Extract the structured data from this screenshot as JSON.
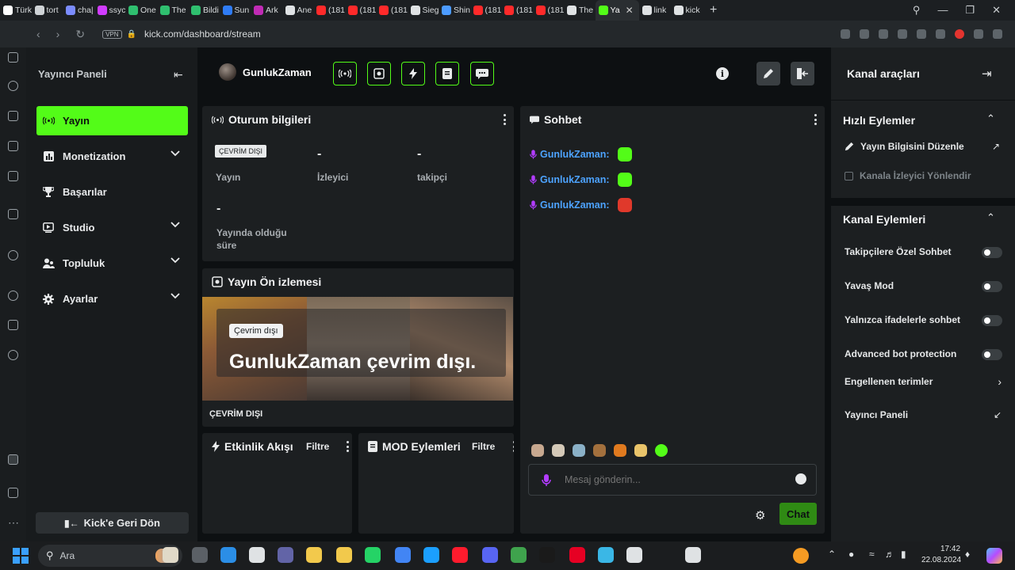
{
  "browser": {
    "tabs": [
      {
        "label": "Türk",
        "color": "#ffffff"
      },
      {
        "label": "tort",
        "color": "#cfd3d6"
      },
      {
        "label": "cha|",
        "color": "#7b8cff"
      },
      {
        "label": "ssyc",
        "color": "#d13cff"
      },
      {
        "label": "One",
        "color": "#2fbf6f"
      },
      {
        "label": "The",
        "color": "#2fbf6f"
      },
      {
        "label": "Bildi",
        "color": "#2fbf6f"
      },
      {
        "label": "Sun",
        "color": "#2f7cf6"
      },
      {
        "label": "Ark",
        "color": "#c02bb5"
      },
      {
        "label": "Ane",
        "color": "#dfe2e4"
      },
      {
        "label": "(181",
        "color": "#ff2a2a"
      },
      {
        "label": "(181",
        "color": "#ff2a2a"
      },
      {
        "label": "(181",
        "color": "#ff2a2a"
      },
      {
        "label": "Sieg",
        "color": "#dfe2e4"
      },
      {
        "label": "Shin",
        "color": "#4c9bff"
      },
      {
        "label": "(181",
        "color": "#ff2a2a"
      },
      {
        "label": "(181",
        "color": "#ff2a2a"
      },
      {
        "label": "(181",
        "color": "#ff2a2a"
      },
      {
        "label": "The",
        "color": "#dfe2e4"
      },
      {
        "label": "Ya",
        "color": "#53fc18",
        "active": true
      },
      {
        "label": "link",
        "color": "#dfe2e4"
      },
      {
        "label": "kick",
        "color": "#dfe2e4"
      }
    ],
    "new_tab": "+",
    "vpn": "VPN",
    "url": "kick.com/dashboard/stream"
  },
  "leftnav": {
    "title": "Yayıncı Paneli",
    "items": [
      {
        "label": "Yayın",
        "icon": "broadcast-icon",
        "active": true
      },
      {
        "label": "Monetization",
        "icon": "chart-icon",
        "chevron": true
      },
      {
        "label": "Başarılar",
        "icon": "trophy-icon"
      },
      {
        "label": "Studio",
        "icon": "studio-icon",
        "chevron": true
      },
      {
        "label": "Topluluk",
        "icon": "community-icon",
        "chevron": true
      },
      {
        "label": "Ayarlar",
        "icon": "gear-icon",
        "chevron": true
      }
    ],
    "back": "Kick'e Geri Dön"
  },
  "header": {
    "username": "GunlukZaman"
  },
  "session": {
    "title": "Oturum bilgileri",
    "status_badge": "ÇEVRİM DIŞI",
    "stats": [
      {
        "value": "-",
        "label": "Yayın"
      },
      {
        "value": "-",
        "label": "İzleyici"
      },
      {
        "value": "-",
        "label": "takipçi"
      },
      {
        "value": "-",
        "label": "Yayında olduğu süre"
      }
    ]
  },
  "preview": {
    "title": "Yayın Ön izlemesi",
    "badge": "Çevrim dışı",
    "message": "GunlukZaman çevrim dışı.",
    "footer": "ÇEVRİM DIŞI"
  },
  "activity": {
    "title": "Etkinlik Akışı",
    "filter": "Filtre"
  },
  "mod": {
    "title": "MOD Eylemleri",
    "filter": "Filtre"
  },
  "chat": {
    "title": "Sohbet",
    "messages": [
      {
        "user": "GunlukZaman:",
        "emote_color": "#53fc18"
      },
      {
        "user": "GunlukZaman:",
        "emote_color": "#53fc18"
      },
      {
        "user": "GunlukZaman:",
        "emote_color": "#e0392b"
      }
    ],
    "input_placeholder": "Mesaj gönderin...",
    "send": "Chat"
  },
  "tools": {
    "title": "Kanal araçları",
    "quick_title": "Hızlı Eylemler",
    "quick": [
      {
        "label": "Yayın Bilgisini Düzenle"
      },
      {
        "label": "Kanala İzleyici Yönlendir"
      }
    ],
    "channel_title": "Kanal Eylemleri",
    "toggles": [
      {
        "label": "Takipçilere Özel Sohbet",
        "on": false
      },
      {
        "label": "Yavaş Mod",
        "on": false
      },
      {
        "label": "Yalnızca ifadelerle sohbet",
        "on": false
      },
      {
        "label": "Advanced bot protection",
        "on": false
      }
    ],
    "links": [
      {
        "label": "Engellenen terimler"
      },
      {
        "label": "Yayıncı Paneli"
      }
    ]
  },
  "taskbar": {
    "search": "Ara",
    "time": "17:42",
    "date": "22.08.2024"
  }
}
